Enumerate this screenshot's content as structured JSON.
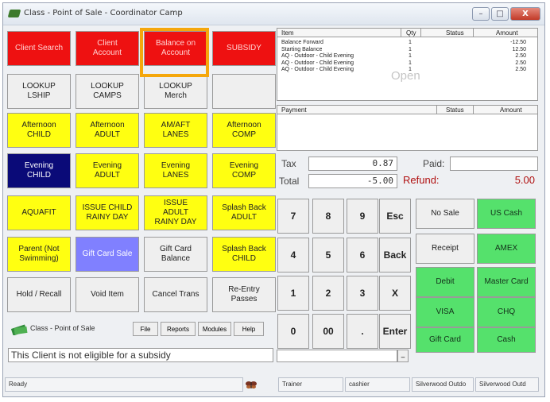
{
  "window": {
    "title": "Class - Point of Sale - Coordinator Camp",
    "close_label": "X"
  },
  "left_buttons": [
    [
      "Client Search",
      "Client\nAccount",
      "Balance on\nAccount",
      "SUBSIDY"
    ],
    [
      "LOOKUP\nLSHIP",
      "LOOKUP\nCAMPS",
      "LOOKUP\nMerch",
      ""
    ],
    [
      "Afternoon\nCHILD",
      "Afternoon\nADULT",
      "AM/AFT\nLANES",
      "Afternoon\nCOMP"
    ],
    [
      "Evening\nCHILD",
      "Evening\nADULT",
      "Evening\nLANES",
      "Evening\nCOMP"
    ],
    [
      "AQUAFIT",
      "ISSUE CHILD\nRAINY DAY",
      "ISSUE\nADULT\nRAINY DAY",
      "Splash Back\nADULT"
    ],
    [
      "Parent (Not\nSwimming)",
      "Gift Card Sale",
      "Gift Card\nBalance",
      "Splash Back\nCHILD"
    ],
    [
      "Hold / Recall",
      "Void Item",
      "Cancel Trans",
      "Re-Entry\nPasses"
    ]
  ],
  "bottom_toolbar": {
    "label": "Class - Point of Sale",
    "buttons": [
      "File",
      "Reports",
      "Modules",
      "Help"
    ]
  },
  "message": "This Client is not eligible for a subsidy",
  "items_table": {
    "headers": [
      "Item",
      "Qty",
      "Status",
      "Amount"
    ],
    "rows": [
      [
        "Balance Forward",
        "1",
        "",
        "-12.50"
      ],
      [
        "Starting Balance",
        "1",
        "",
        "12.50"
      ],
      [
        "AQ - Outdoor - Child Evening",
        "1",
        "",
        "2.50"
      ],
      [
        "AQ - Outdoor - Child Evening",
        "1",
        "",
        "2.50"
      ],
      [
        "AQ - Outdoor - Child Evening",
        "1",
        "",
        "2.50"
      ]
    ],
    "watermark": "Open"
  },
  "payment_table": {
    "headers": [
      "Payment",
      "Status",
      "Amount"
    ]
  },
  "totals": {
    "tax_label": "Tax",
    "tax_value": "0.87",
    "total_label": "Total",
    "total_value": "-5.00",
    "paid_label": "Paid:",
    "paid_value": "",
    "refund_label": "Refund:",
    "refund_value": "5.00"
  },
  "keypad": [
    [
      "7",
      "8",
      "9",
      "Esc"
    ],
    [
      "4",
      "5",
      "6",
      "Back"
    ],
    [
      "1",
      "2",
      "3",
      "X"
    ],
    [
      "0",
      "00",
      ".",
      "Enter"
    ]
  ],
  "action_buttons": [
    [
      "No Sale",
      "US Cash"
    ],
    [
      "Receipt",
      "AMEX"
    ],
    [
      "Debit",
      "Master Card"
    ],
    [
      "VISA",
      "CHQ"
    ],
    [
      "Gift Card",
      "Cash"
    ]
  ],
  "entry": {
    "value": "",
    "dropdown_label": "_"
  },
  "statusbar": [
    "Ready",
    "Trainer",
    "cashier",
    "Silverwood Outdo",
    "Silverwood Outd"
  ],
  "colors": {
    "red": "#ee1111",
    "yellow": "#ffff11",
    "navy": "#0a0a78",
    "green": "#55e16c",
    "purple": "#8080ff",
    "highlight": "#f5a70c",
    "refund": "#b01010"
  }
}
